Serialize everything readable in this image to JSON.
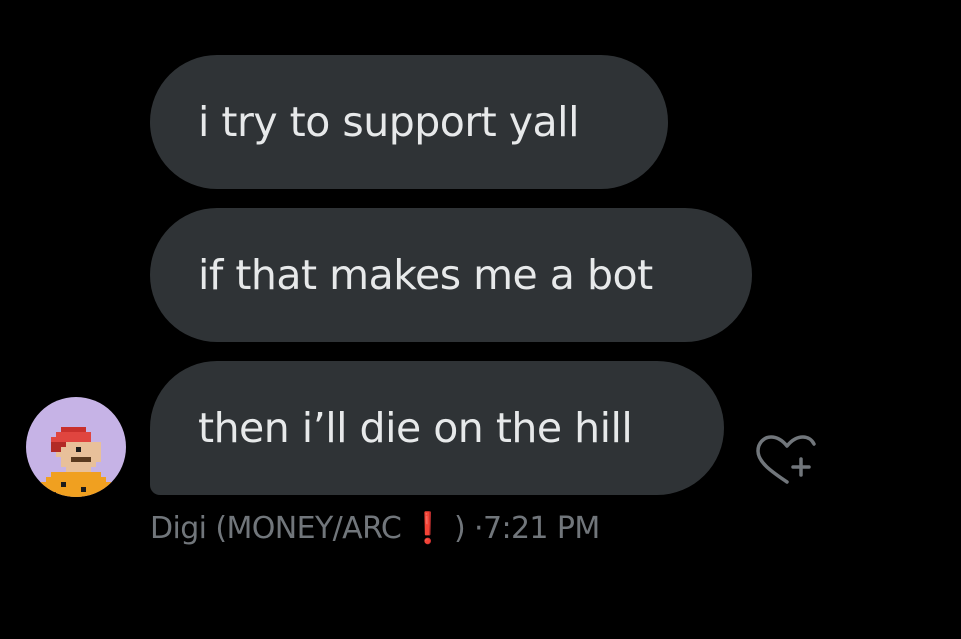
{
  "conversation": {
    "messages": [
      {
        "text": "i try to support yall"
      },
      {
        "text": "if that makes me a bot"
      },
      {
        "text": "then i’ll die on the hill"
      }
    ],
    "sender": {
      "name_prefix": "Digi (MONEY/ARC",
      "emoji": "❗",
      "name_suffix": ")",
      "separator": "·",
      "timestamp": "7:21 PM",
      "avatar_icon": "pixel-character-avatar"
    },
    "reaction_icon": "heart-plus-icon"
  },
  "colors": {
    "background": "#000000",
    "bubble": "#2f3336",
    "bubble_text": "#e7e9ea",
    "meta_text": "#71767b",
    "avatar_bg": "#c6b3e6",
    "emoji_red": "#dd1a1a"
  }
}
